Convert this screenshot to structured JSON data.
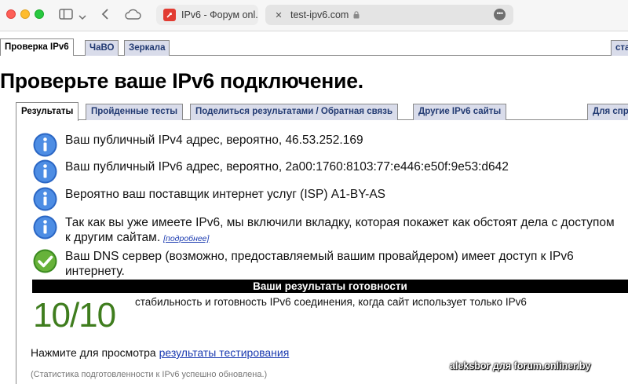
{
  "browser": {
    "tabs": [
      {
        "label": "IPv6 - Форум onl..."
      },
      {
        "label": "test-ipv6.com"
      }
    ],
    "colors": {
      "red": "#fe5f57",
      "yellow": "#febc2e",
      "green": "#28c840"
    }
  },
  "site_tabs": [
    {
      "label": "Проверка IPv6",
      "active": true
    },
    {
      "label": "ЧаВО",
      "active": false
    },
    {
      "label": "Зеркала",
      "active": false
    },
    {
      "label": "ста",
      "active": false
    }
  ],
  "page_title": "Проверьте ваше IPv6 подключение.",
  "result_tabs": [
    {
      "label": "Результаты",
      "active": true
    },
    {
      "label": "Пройденные тесты",
      "active": false
    },
    {
      "label": "Поделиться результатами / Обратная связь",
      "active": false
    },
    {
      "label": "Другие IPv6 сайты",
      "active": false
    },
    {
      "label": "Для спр",
      "active": false
    }
  ],
  "results": [
    {
      "icon": "info-icon",
      "text": "Ваш публичный IPv4 адрес, вероятно, 46.53.252.169"
    },
    {
      "icon": "info-icon",
      "text": "Ваш публичный IPv6 адрес, вероятно, 2a00:1760:8103:77:e446:e50f:9e53:d642"
    },
    {
      "icon": "info-icon",
      "text": "Вероятно ваш поставщик интернет услуг (ISP) A1-BY-AS"
    },
    {
      "icon": "info-icon",
      "text": "Так как вы уже имеете IPv6, мы включили вкладку, которая покажет как обстоят дела с доступом к другим сайтам.",
      "link": "[подробнее]"
    },
    {
      "icon": "check-icon",
      "text": "Ваш DNS сервер (возможно, предоставляемый вашим провайдером) имеет доступ к IPv6 интернету."
    }
  ],
  "readiness": {
    "header": "Ваши результаты готовности",
    "score": "10/10",
    "description": "стабильность и готовность IPv6 соединения, когда сайт использует только IPv6",
    "score_color": "#3f7d1e"
  },
  "view": {
    "prefix": "Нажмите для просмотра",
    "link": "результаты тестирования"
  },
  "stats_note": "(Статистика подготовленности к IPv6 успешно обновлена.)",
  "watermark": "aleksbor для forum.onliner.by"
}
